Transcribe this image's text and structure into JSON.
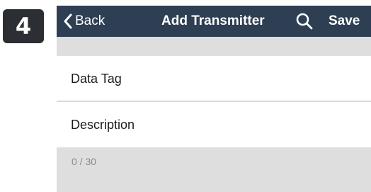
{
  "step": {
    "number": "4"
  },
  "navbar": {
    "back_label": "Back",
    "title": "Add Transmitter",
    "search_icon": "search-icon",
    "save_label": "Save"
  },
  "form": {
    "fields": [
      {
        "label": "Data Tag",
        "value": ""
      },
      {
        "label": "Description",
        "value": ""
      }
    ],
    "char_counter": "0 / 30"
  },
  "colors": {
    "navbar": "#2e3e53",
    "background": "#dedede",
    "badge": "#2b2f33"
  }
}
